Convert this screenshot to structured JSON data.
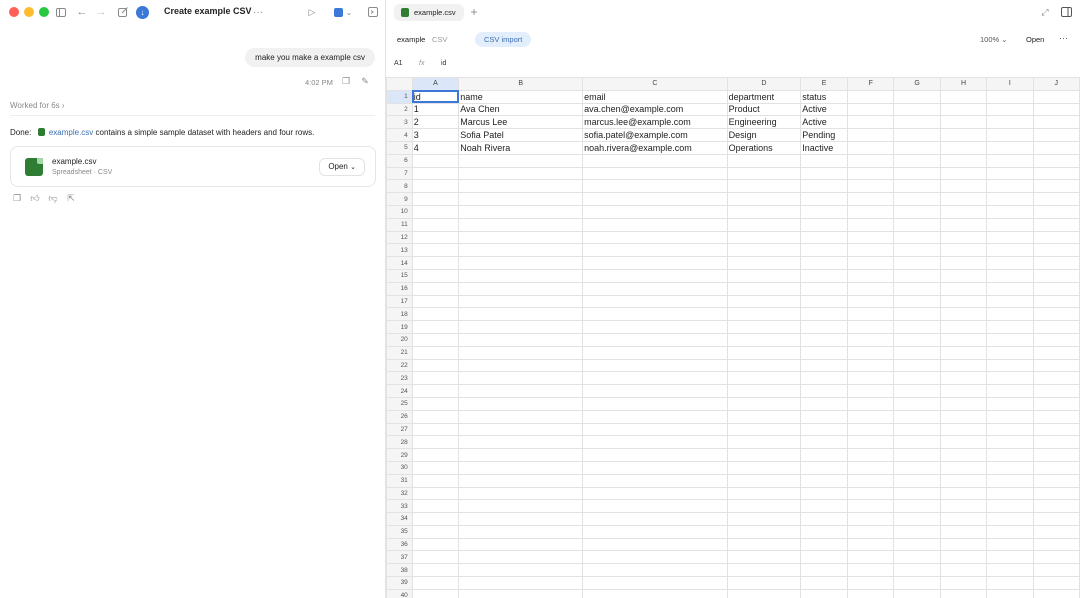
{
  "window": {
    "title": "Create example CSV"
  },
  "chat": {
    "user_message": "make you make a example csv",
    "time": "4:02 PM",
    "worked": "Worked for 6s",
    "done_prefix": "Done:",
    "done_link": "example.csv",
    "done_suffix": "contains a simple sample dataset with headers and four rows.",
    "file_name": "example.csv",
    "file_type": "Spreadsheet · CSV",
    "open_label": "Open"
  },
  "viewer": {
    "tab_label": "example.csv",
    "doc_name": "example",
    "doc_type": "CSV",
    "import_label": "CSV import",
    "zoom": "100%",
    "open_label": "Open",
    "cell_ref": "A1",
    "fx": "fx",
    "formula_value": "id"
  },
  "sheet": {
    "columns": [
      "A",
      "B",
      "C",
      "D",
      "E",
      "F",
      "G",
      "H",
      "I",
      "J"
    ],
    "rows": [
      [
        "id",
        "name",
        "email",
        "department",
        "status"
      ],
      [
        "1",
        "Ava Chen",
        "ava.chen@example.com",
        "Product",
        "Active"
      ],
      [
        "2",
        "Marcus Lee",
        "marcus.lee@example.com",
        "Engineering",
        "Active"
      ],
      [
        "3",
        "Sofia Patel",
        "sofia.patel@example.com",
        "Design",
        "Pending"
      ],
      [
        "4",
        "Noah Rivera",
        "noah.rivera@example.com",
        "Operations",
        "Inactive"
      ]
    ],
    "row_count": 40
  },
  "colors": {
    "accent": "#3b78d8",
    "file_green": "#2e7d32",
    "pill_bg": "#e3eefc"
  }
}
